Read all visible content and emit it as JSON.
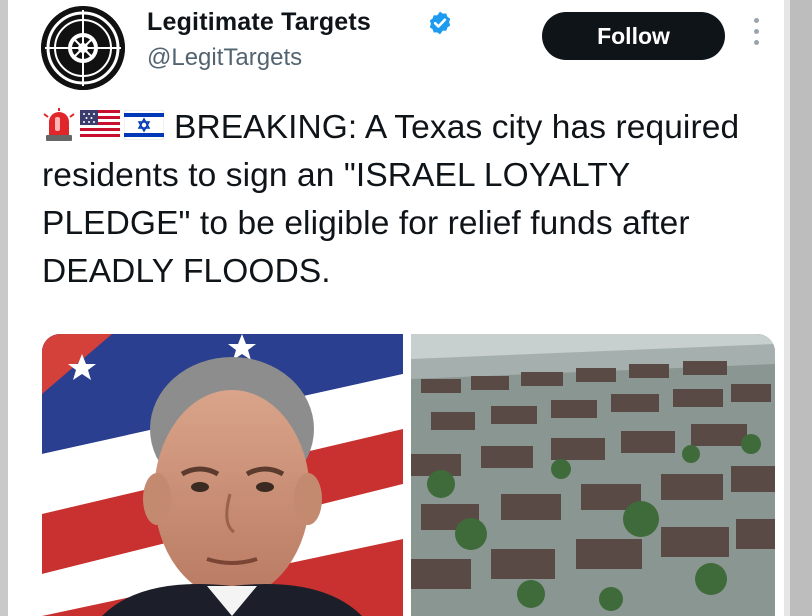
{
  "account": {
    "display_name": "Legitimate Targets",
    "handle": "@LegitTargets",
    "verified": true,
    "avatar_icon": "target-crosshair-logo"
  },
  "actions": {
    "follow_label": "Follow",
    "more_icon": "vertical-ellipsis-icon"
  },
  "tweet": {
    "emojis": [
      "police-light-emoji",
      "us-flag-emoji",
      "israel-flag-emoji"
    ],
    "text": "BREAKING: A Texas city has required residents to sign an \"ISRAEL LOYALTY PLEDGE\" to be eligible for relief funds after DEADLY FLOODS."
  },
  "media": [
    {
      "name": "portrait-photo"
    },
    {
      "name": "flood-aerial-photo"
    }
  ],
  "colors": {
    "follow_bg": "#0f1419",
    "verified_blue": "#1d9bf0",
    "handle_gray": "#536471"
  }
}
